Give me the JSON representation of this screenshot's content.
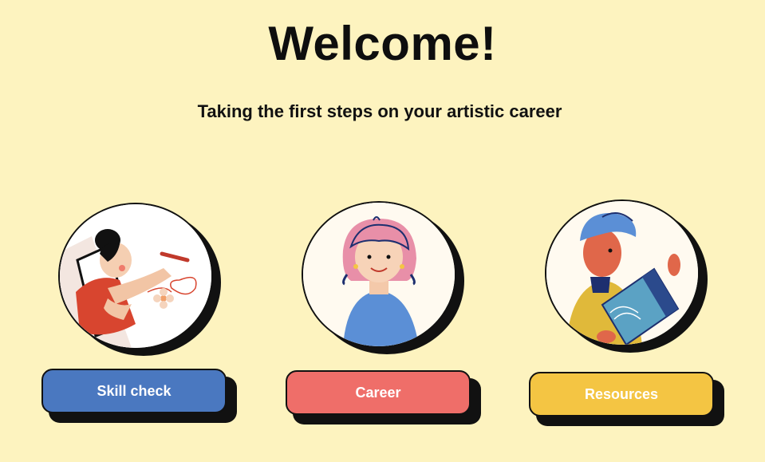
{
  "header": {
    "title": "Welcome!",
    "subtitle": "Taking the first steps on your artistic career"
  },
  "cards": [
    {
      "label": "Skill check",
      "color": "#4a78c0",
      "illustration": "artist-drawing-icon"
    },
    {
      "label": "Career",
      "color": "#ef6e69",
      "illustration": "girl-portrait-icon"
    },
    {
      "label": "Resources",
      "color": "#f4c543",
      "illustration": "man-reading-book-icon"
    }
  ],
  "colors": {
    "background": "#fdf3bf",
    "outline": "#111111"
  }
}
